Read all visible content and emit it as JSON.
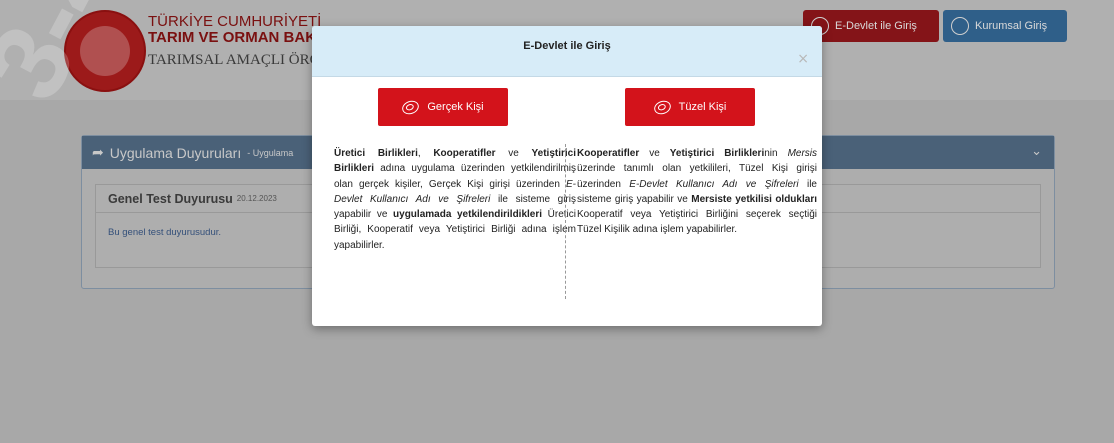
{
  "header": {
    "brand_line1": "TÜRKİYE CUMHURİYETİ",
    "brand_line2": "TARIM VE ORMAN BAKA",
    "brand_line3": "TARIMSAL AMAÇLI ÖRGÜTLERİN DE",
    "edevlet_button": "E-Devlet ile Giriş",
    "kurumsal_button": "Kurumsal Giriş"
  },
  "announcements": {
    "title": "Uygulama Duyuruları",
    "subtitle": "- Uygulama",
    "item_title": "Genel Test Duyurusu",
    "item_date": "20.12.2023",
    "item_text": "Bu genel test duyurusudur."
  },
  "watermark": "3-45...",
  "modal": {
    "title": "E-Devlet ile Giriş",
    "close": "×",
    "gercek_button": "Gerçek Kişi",
    "tuzel_button": "Tüzel Kişi",
    "left": {
      "b1": "Üretici Birlikleri",
      "t1": ", ",
      "b2": "Kooperatifler",
      "t2": " ve ",
      "b3": "Yetiştirici Birlikleri",
      "t3": " adına uygulama üzerinden yetkilendirilmiş olan gerçek kişiler, Gerçek Kişi girişi üzerinden ",
      "i1": "E-Devlet Kullanıcı Adı ve Şifreleri",
      "t4": " ile sisteme giriş yapabilir ve ",
      "b4": "uygulamada yetkilendirildikleri",
      "t5": " Üretici Birliği, Kooperatif veya Yetiştirici Birliği adına işlem yapabilirler."
    },
    "right": {
      "b1": "Kooperatifler",
      "t1": " ve ",
      "b2": "Yetiştirici Birlikleri",
      "t2": "nin ",
      "i1": "Mersis",
      "t3": " üzerinde tanımlı olan yetkilileri, Tüzel Kişi girişi üzerinden ",
      "i2": "E-Devlet Kullanıcı Adı ve Şifreleri",
      "t4": " ile sisteme giriş yapabilir ve ",
      "b3": "Mersiste yetkilisi oldukları",
      "t5": " Kooperatif veya Yetiştirici Birliğini seçerek seçtiği Tüzel Kişilik adına işlem yapabilirler."
    }
  }
}
